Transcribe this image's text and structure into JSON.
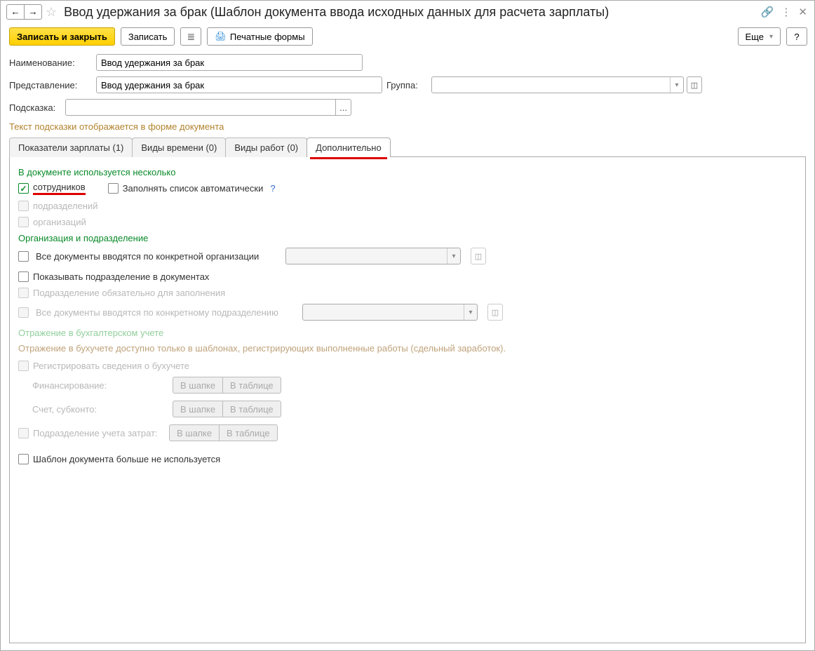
{
  "header": {
    "title": "Ввод удержания за брак (Шаблон документа ввода исходных данных для расчета зарплаты)"
  },
  "toolbar": {
    "save_close": "Записать и закрыть",
    "save": "Записать",
    "print_forms": "Печатные формы",
    "more": "Еще",
    "help": "?"
  },
  "fields": {
    "name_label": "Наименование:",
    "name_value": "Ввод удержания за брак",
    "repr_label": "Представление:",
    "repr_value": "Ввод удержания за брак",
    "group_label": "Группа:",
    "group_value": "",
    "hint_label": "Подсказка:",
    "hint_value": "",
    "hint_note": "Текст подсказки отображается в форме документа"
  },
  "tabs": {
    "t0": "Показатели зарплаты (1)",
    "t1": "Виды времени (0)",
    "t2": "Виды работ (0)",
    "t3": "Дополнительно"
  },
  "section1": {
    "title": "В документе используется несколько",
    "employees": "сотрудников",
    "autofill": "Заполнять список автоматически",
    "departments": "подразделений",
    "orgs": "организаций"
  },
  "section2": {
    "title": "Организация и подразделение",
    "by_org": "Все документы вводятся по конкретной организации",
    "show_dept": "Показывать подразделение в документах",
    "dept_required": "Подразделение обязательно для заполнения",
    "by_dept": "Все документы вводятся по конкретному подразделению"
  },
  "section3": {
    "title": "Отражение в бухгалтерском учете",
    "note": "Отражение в бухучете доступно только в шаблонах, регистрирующих выполненные работы (сдельный заработок).",
    "register": "Регистрировать сведения о бухучете",
    "financing": "Финансирование:",
    "account": "Счет, субконто:",
    "cost_dept": "Подразделение учета затрат:",
    "in_header": "В шапке",
    "in_table": "В таблице"
  },
  "section4": {
    "not_used": "Шаблон документа больше не используется"
  }
}
